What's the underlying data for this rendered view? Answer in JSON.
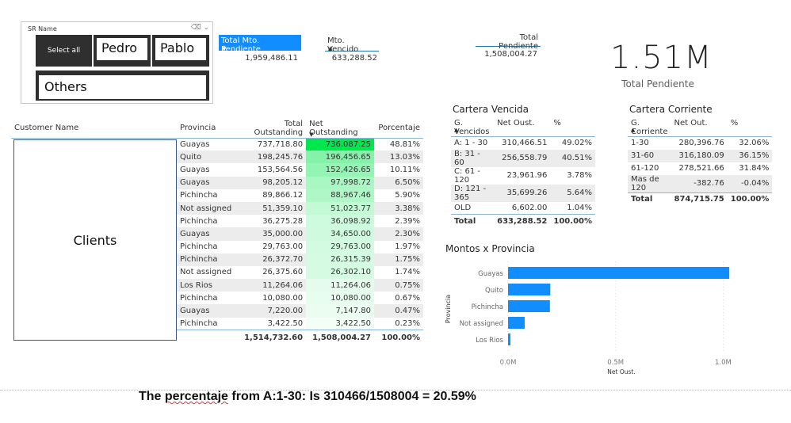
{
  "slicer": {
    "title": "SR Name",
    "icons": [
      "eraser-icon",
      "chevron-down-icon"
    ],
    "options": [
      "Select all",
      "Pedro",
      "Pablo",
      "Others"
    ]
  },
  "kpis": [
    {
      "label": "Total Mto. Pendiente",
      "value": "1,959,486.11",
      "sort": "desc",
      "highlighted": true
    },
    {
      "label": "Mto. Vencido",
      "value": "633,288.52",
      "sort": "asc"
    },
    {
      "label": "Total Pendiente",
      "value": "1,508,004.27"
    }
  ],
  "card": {
    "value": "1.51M",
    "label": "Total Pendiente"
  },
  "main_table": {
    "columns": [
      "Customer Name",
      "Provincia",
      "Total Outstanding",
      "Net Outstanding",
      "Porcentaje"
    ],
    "clients_placeholder": "Clients",
    "rows": [
      {
        "provincia": "Guayas",
        "total": "737,718.80",
        "net": "736,087.25",
        "pct": "48.81%",
        "net_value": 736087.25
      },
      {
        "provincia": "Quito",
        "total": "198,245.76",
        "net": "196,456.65",
        "pct": "13.03%",
        "net_value": 196456.65
      },
      {
        "provincia": "Guayas",
        "total": "153,564.56",
        "net": "152,426.65",
        "pct": "10.11%",
        "net_value": 152426.65
      },
      {
        "provincia": "Guayas",
        "total": "98,205.12",
        "net": "97,998.72",
        "pct": "6.50%",
        "net_value": 97998.72
      },
      {
        "provincia": "Pichincha",
        "total": "89,866.12",
        "net": "88,967.46",
        "pct": "5.90%",
        "net_value": 88967.46
      },
      {
        "provincia": "Not assigned",
        "total": "51,359.10",
        "net": "51,023.77",
        "pct": "3.38%",
        "net_value": 51023.77
      },
      {
        "provincia": "Pichincha",
        "total": "36,275.28",
        "net": "36,098.92",
        "pct": "2.39%",
        "net_value": 36098.92
      },
      {
        "provincia": "Guayas",
        "total": "35,000.00",
        "net": "34,650.00",
        "pct": "2.30%",
        "net_value": 34650.0
      },
      {
        "provincia": "Pichincha",
        "total": "29,763.00",
        "net": "29,763.00",
        "pct": "1.97%",
        "net_value": 29763.0
      },
      {
        "provincia": "Pichincha",
        "total": "26,372.70",
        "net": "26,315.39",
        "pct": "1.75%",
        "net_value": 26315.39
      },
      {
        "provincia": "Not assigned",
        "total": "26,375.60",
        "net": "26,302.10",
        "pct": "1.74%",
        "net_value": 26302.1
      },
      {
        "provincia": "Los Rios",
        "total": "11,264.06",
        "net": "11,264.06",
        "pct": "0.75%",
        "net_value": 11264.06
      },
      {
        "provincia": "Pichincha",
        "total": "10,080.00",
        "net": "10,080.00",
        "pct": "0.67%",
        "net_value": 10080.0
      },
      {
        "provincia": "Guayas",
        "total": "7,220.00",
        "net": "7,147.80",
        "pct": "0.47%",
        "net_value": 7147.8
      },
      {
        "provincia": "Pichincha",
        "total": "3,422.50",
        "net": "3,422.50",
        "pct": "0.23%",
        "net_value": 3422.5
      }
    ],
    "totals": {
      "total": "1,514,732.60",
      "net": "1,508,004.27",
      "pct": "100.00%"
    },
    "heat_color": "#00e64d"
  },
  "cartera_vencida": {
    "title": "Cartera Vencida",
    "columns": [
      "G. Vencidos",
      "Net Oust.",
      "%"
    ],
    "rows": [
      [
        "A: 1 - 30",
        "310,466.51",
        "49.02%"
      ],
      [
        "B: 31 - 60",
        "256,558.79",
        "40.51%"
      ],
      [
        "C: 61 - 120",
        "23,961.96",
        "3.78%"
      ],
      [
        "D: 121 - 365",
        "35,699.26",
        "5.64%"
      ],
      [
        "OLD",
        "6,602.00",
        "1.04%"
      ]
    ],
    "total": [
      "Total",
      "633,288.52",
      "100.00%"
    ]
  },
  "cartera_corriente": {
    "title": "Cartera Corriente",
    "columns": [
      "G. Corriente",
      "Net Out.",
      "%"
    ],
    "rows": [
      [
        "1-30",
        "280,396.76",
        "32.06%"
      ],
      [
        "31-60",
        "316,180.09",
        "36.15%"
      ],
      [
        "61-120",
        "278,521.66",
        "31.84%"
      ],
      [
        "Mas de 120",
        "-382.76",
        "-0.04%"
      ]
    ],
    "total": [
      "Total",
      "874,715.75",
      "100.00%"
    ]
  },
  "chart_data": {
    "type": "bar",
    "orientation": "horizontal",
    "title": "Montos x Provincia",
    "categories": [
      "Guayas",
      "Quito",
      "Pichincha",
      "Not assigned",
      "Los Rios"
    ],
    "values": [
      1028310.42,
      196456.65,
      194647.27,
      77325.87,
      11264.06
    ],
    "xlabel": "Net Oust.",
    "ylabel": "Provincia",
    "xlim": [
      0,
      1050000
    ],
    "xticks": [
      0,
      500000,
      1000000
    ],
    "xtick_labels": [
      "0.0M",
      "0.5M",
      "1.0M"
    ],
    "grid": true,
    "bar_color": "#118dff"
  },
  "note": {
    "prefix": "The ",
    "misspelled": "percentaje",
    "suffix": " from A:1-30: Is 310466/1508004 = 20.59%"
  }
}
